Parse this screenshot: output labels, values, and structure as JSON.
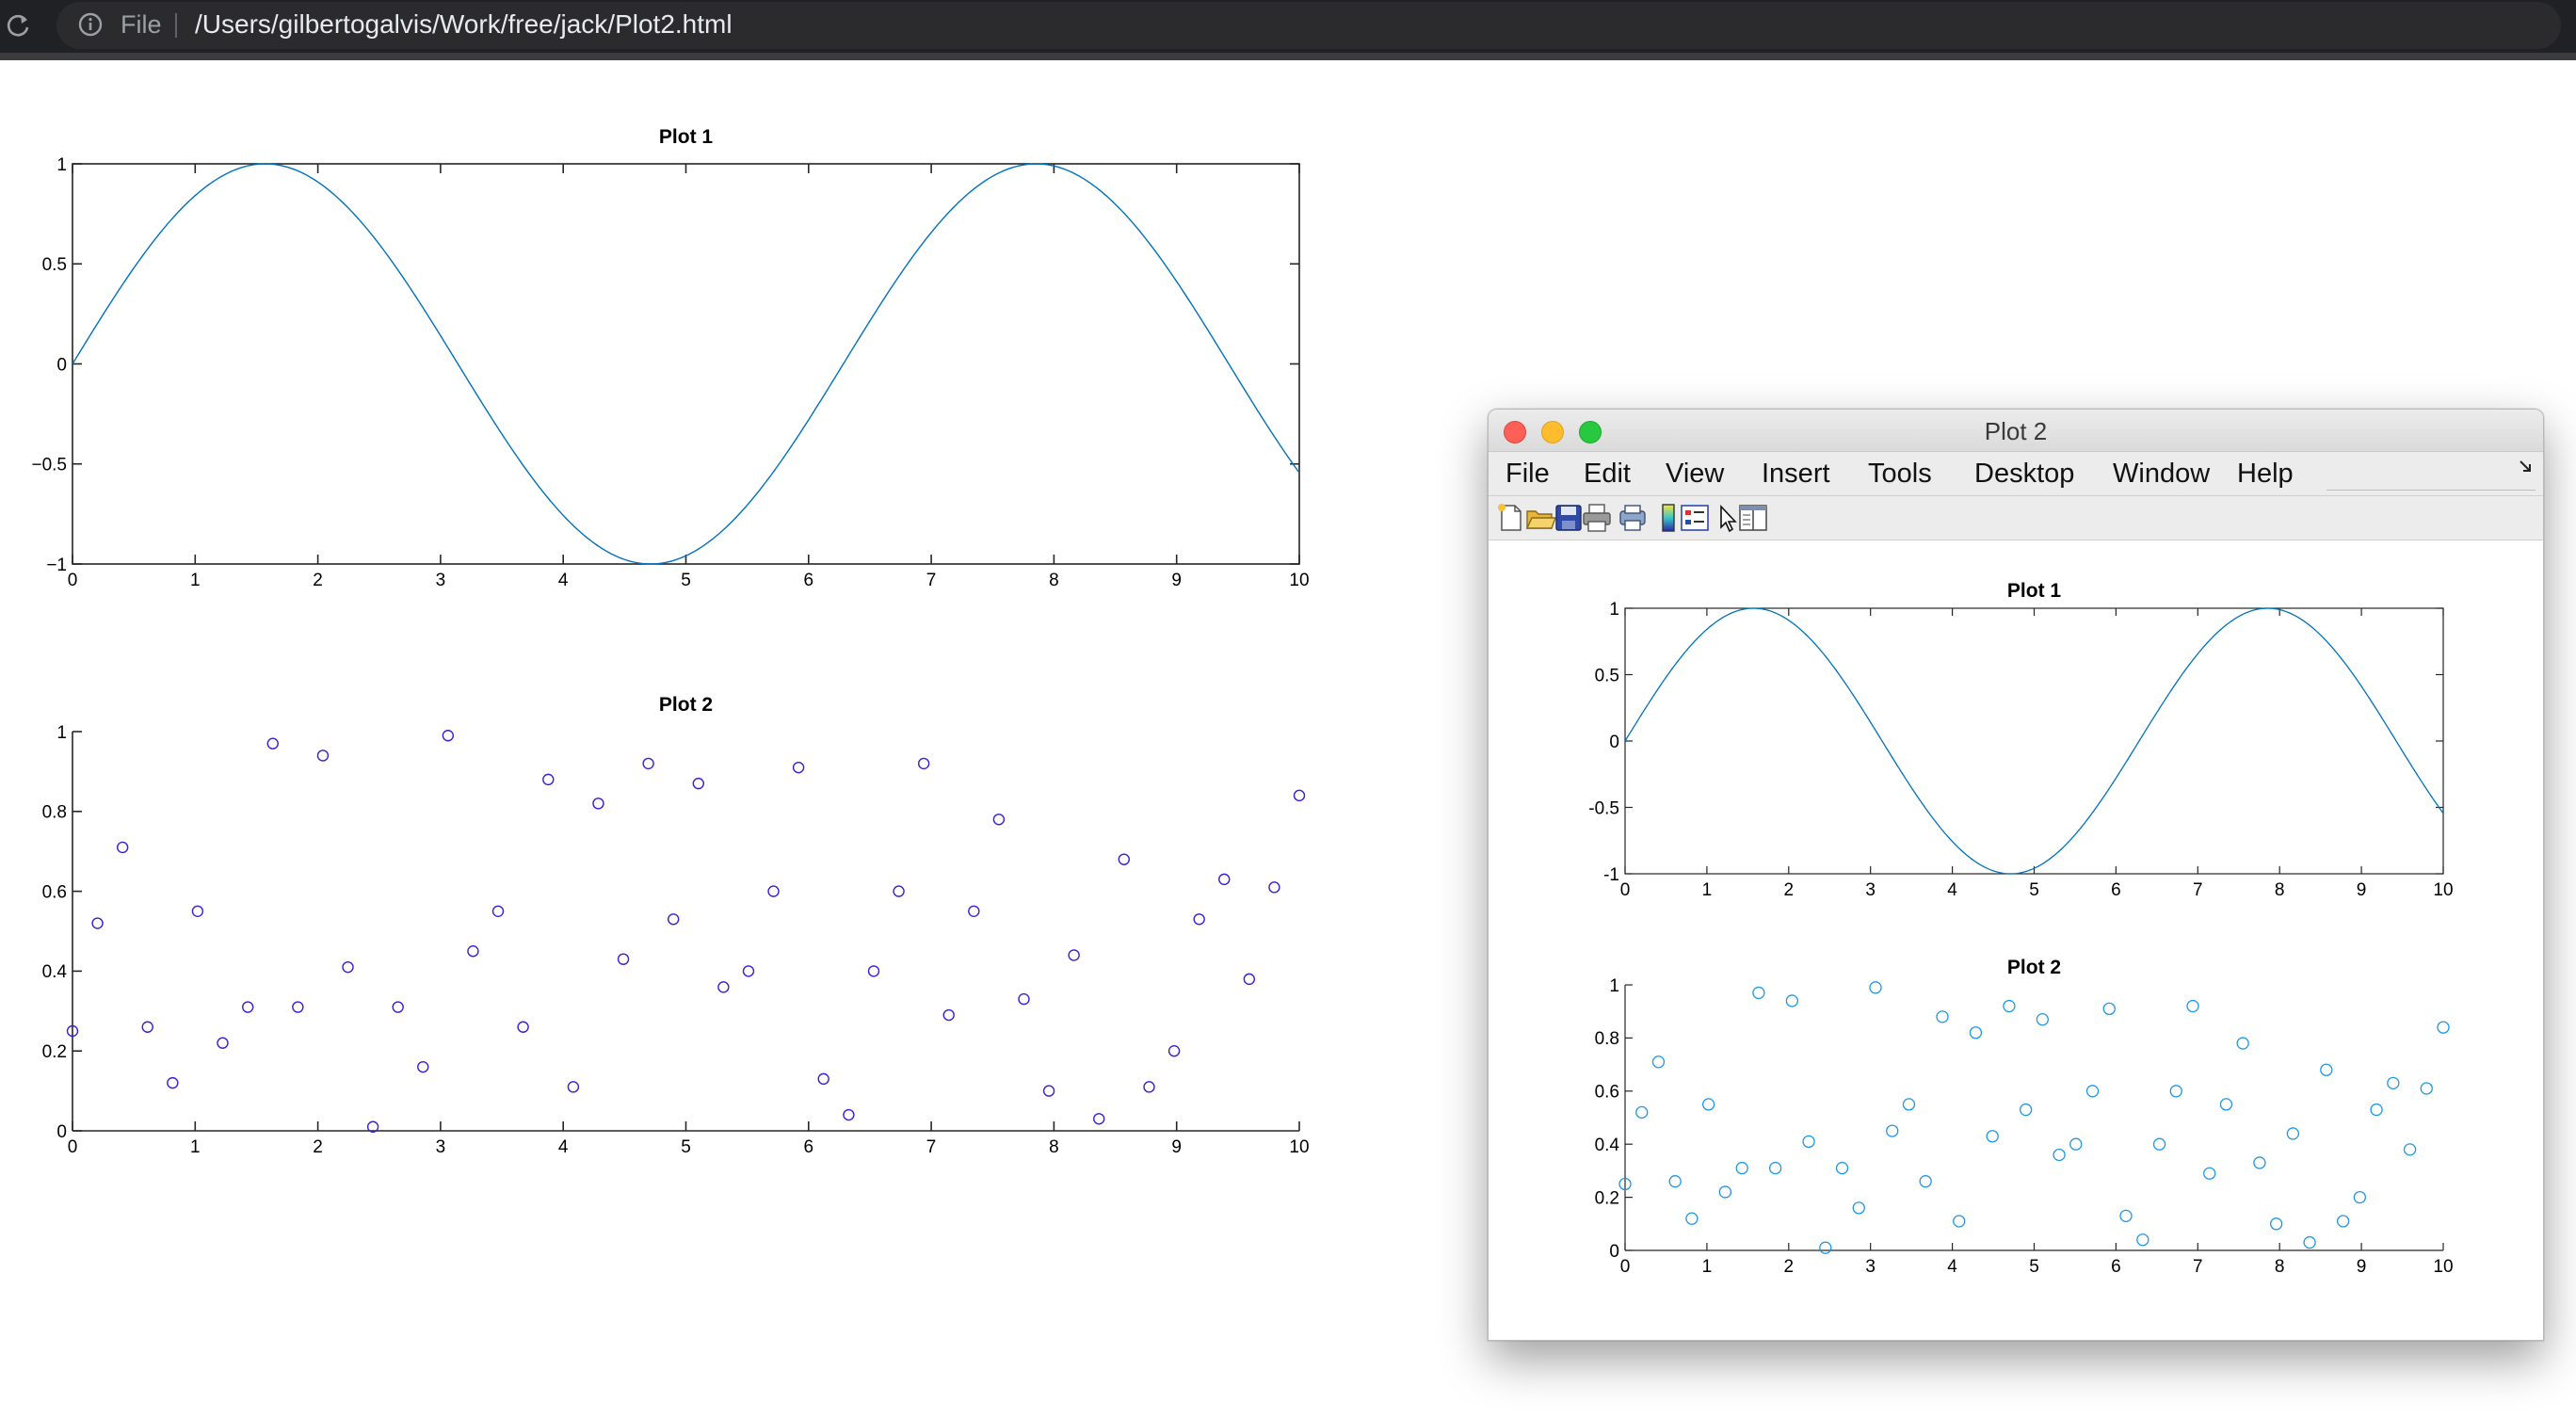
{
  "browser": {
    "scheme_label": "File",
    "url": "/Users/gilbertogalvis/Work/free/jack/Plot2.html"
  },
  "figure_window": {
    "title": "Plot 2",
    "menu": [
      "File",
      "Edit",
      "View",
      "Insert",
      "Tools",
      "Desktop",
      "Window",
      "Help"
    ],
    "toolbar_icons": [
      "new-figure-icon",
      "open-file-icon",
      "save-icon",
      "print-icon",
      "print-preview-icon",
      "colorbar-icon",
      "legend-icon",
      "pointer-icon",
      "property-editor-icon"
    ]
  },
  "colors": {
    "line_blue": "#0072bd",
    "scatter_page": "#3a1fd6",
    "scatter_figure": "#1f96e6"
  },
  "chart_data": [
    {
      "id": "page-plot-1",
      "type": "line",
      "title": "Plot 1",
      "function": "sin(x)",
      "xlim": [
        0,
        10
      ],
      "ylim": [
        -1,
        1
      ],
      "xticks": [
        "0",
        "1",
        "2",
        "3",
        "4",
        "5",
        "6",
        "7",
        "8",
        "9",
        "10"
      ],
      "yticks": [
        "−1",
        "−0.5",
        "0",
        "0.5",
        "1"
      ],
      "grid": false
    },
    {
      "id": "page-plot-2",
      "type": "scatter",
      "title": "Plot 2",
      "xlim": [
        0,
        10
      ],
      "ylim": [
        0,
        1
      ],
      "xticks": [
        "0",
        "1",
        "2",
        "3",
        "4",
        "5",
        "6",
        "7",
        "8",
        "9",
        "10"
      ],
      "yticks": [
        "0",
        "0.2",
        "0.4",
        "0.6",
        "0.8",
        "1"
      ],
      "x": [
        0,
        0.204,
        0.408,
        0.612,
        0.816,
        1.02,
        1.224,
        1.429,
        1.633,
        1.837,
        2.041,
        2.245,
        2.449,
        2.653,
        2.857,
        3.061,
        3.265,
        3.469,
        3.673,
        3.878,
        4.082,
        4.286,
        4.49,
        4.694,
        4.898,
        5.102,
        5.306,
        5.51,
        5.714,
        5.918,
        6.122,
        6.327,
        6.531,
        6.735,
        6.939,
        7.143,
        7.347,
        7.551,
        7.755,
        7.959,
        8.163,
        8.367,
        8.571,
        8.776,
        8.98,
        9.184,
        9.388,
        9.592,
        9.796,
        10
      ],
      "y": [
        0.25,
        0.52,
        0.71,
        0.26,
        0.12,
        0.55,
        0.22,
        0.31,
        0.97,
        0.31,
        0.94,
        0.41,
        0.01,
        0.31,
        0.16,
        0.99,
        0.45,
        0.55,
        0.26,
        0.88,
        0.11,
        0.82,
        0.43,
        0.92,
        0.53,
        0.87,
        0.36,
        0.4,
        0.6,
        0.91,
        0.13,
        0.04,
        0.4,
        0.6,
        0.92,
        0.29,
        0.55,
        0.78,
        0.33,
        0.1,
        0.44,
        0.03,
        0.68,
        0.11,
        0.2,
        0.53,
        0.63,
        0.38,
        0.61,
        0.84
      ],
      "marker": "o"
    },
    {
      "id": "fig-plot-1",
      "type": "line",
      "title": "Plot 1",
      "function": "sin(x)",
      "xlim": [
        0,
        10
      ],
      "ylim": [
        -1,
        1
      ],
      "xticks": [
        "0",
        "1",
        "2",
        "3",
        "4",
        "5",
        "6",
        "7",
        "8",
        "9",
        "10"
      ],
      "yticks": [
        "-1",
        "-0.5",
        "0",
        "0.5",
        "1"
      ],
      "grid": false
    },
    {
      "id": "fig-plot-2",
      "type": "scatter",
      "title": "Plot 2",
      "xlim": [
        0,
        10
      ],
      "ylim": [
        0,
        1
      ],
      "xticks": [
        "0",
        "1",
        "2",
        "3",
        "4",
        "5",
        "6",
        "7",
        "8",
        "9",
        "10"
      ],
      "yticks": [
        "0",
        "0.2",
        "0.4",
        "0.6",
        "0.8",
        "1"
      ],
      "same_data_as": "page-plot-2",
      "marker": "o"
    }
  ]
}
